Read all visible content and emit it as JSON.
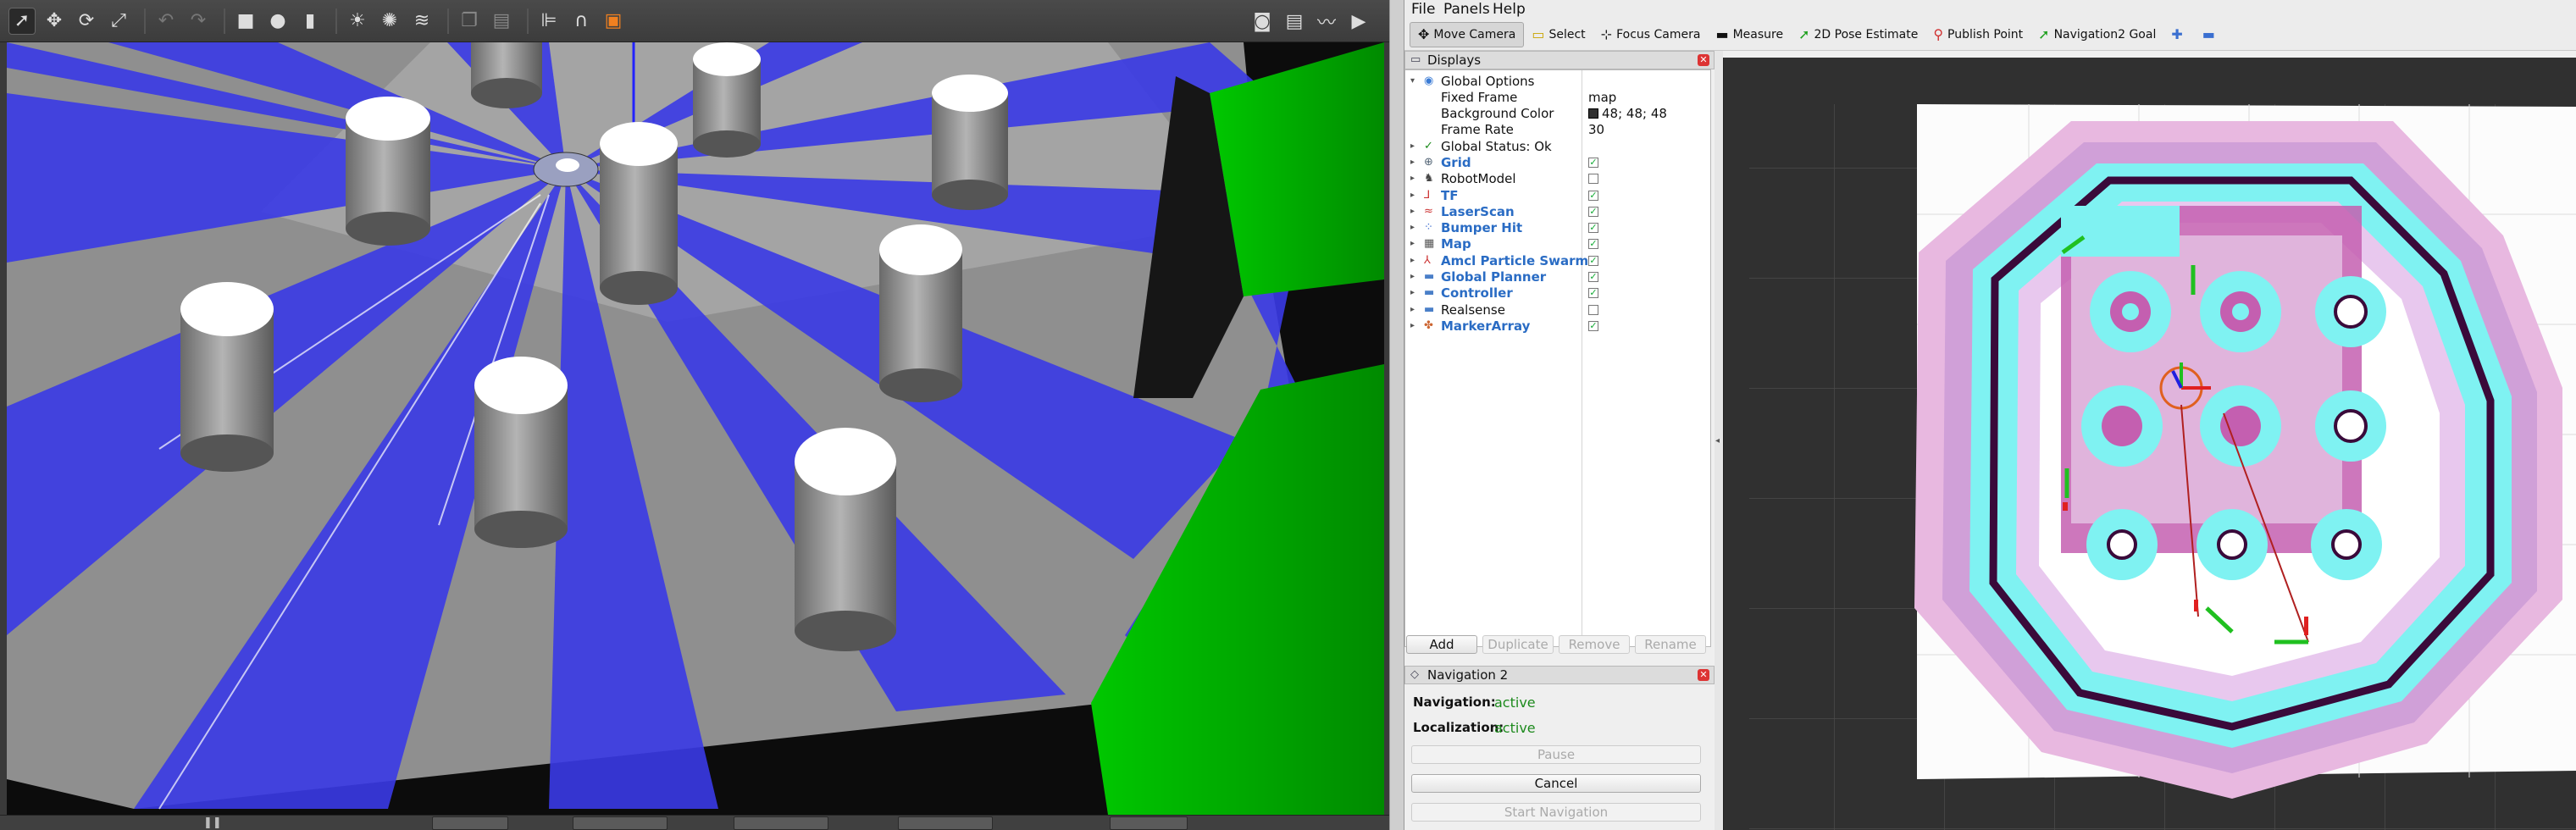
{
  "gazebo": {
    "toolbar_left": [
      "select-mode",
      "translate-mode",
      "rotate-mode",
      "scale-mode",
      "undo",
      "redo",
      "box-shape",
      "sphere-shape",
      "cylinder-shape",
      "point-light",
      "spot-light",
      "directional-light",
      "copy",
      "paste",
      "align",
      "snap",
      "change-view"
    ],
    "toolbar_right": [
      "screenshot",
      "log",
      "plot",
      "record-video"
    ]
  },
  "menubar": {
    "file": "File",
    "panels": "Panels",
    "help": "Help"
  },
  "toolbar": {
    "move_camera": "Move Camera",
    "select": "Select",
    "focus_camera": "Focus Camera",
    "measure": "Measure",
    "pose_estimate": "2D Pose Estimate",
    "publish_point": "Publish Point",
    "nav2_goal": "Navigation2 Goal"
  },
  "displays": {
    "title": "Displays",
    "global_options": {
      "label": "Global Options",
      "fixed_frame_label": "Fixed Frame",
      "fixed_frame_value": "map",
      "bg_color_label": "Background Color",
      "bg_color_value": "48; 48; 48",
      "frame_rate_label": "Frame Rate",
      "frame_rate_value": "30"
    },
    "global_status": "Global Status: Ok",
    "items": [
      {
        "label": "Grid",
        "checked": true,
        "blue": true
      },
      {
        "label": "RobotModel",
        "checked": false,
        "blue": false
      },
      {
        "label": "TF",
        "checked": true,
        "blue": true
      },
      {
        "label": "LaserScan",
        "checked": true,
        "blue": true
      },
      {
        "label": "Bumper Hit",
        "checked": true,
        "blue": true
      },
      {
        "label": "Map",
        "checked": true,
        "blue": true
      },
      {
        "label": "Amcl Particle Swarm",
        "checked": true,
        "blue": true
      },
      {
        "label": "Global Planner",
        "checked": true,
        "blue": true
      },
      {
        "label": "Controller",
        "checked": true,
        "blue": true
      },
      {
        "label": "Realsense",
        "checked": false,
        "blue": false
      },
      {
        "label": "MarkerArray",
        "checked": true,
        "blue": true
      }
    ],
    "buttons": {
      "add": "Add",
      "duplicate": "Duplicate",
      "remove": "Remove",
      "rename": "Rename"
    }
  },
  "nav2": {
    "title": "Navigation 2",
    "navigation_label": "Navigation:",
    "navigation_value": "active",
    "localization_label": "Localization:",
    "localization_value": "active",
    "pause": "Pause",
    "cancel": "Cancel",
    "start": "Start Navigation"
  },
  "colors": {
    "rviz_background": "#303030",
    "laser_blue": "#3a3ae6",
    "active_green": "#1d8a1d",
    "costmap_cyan": "#7ff2f2",
    "costmap_magenta": "#d23ca8",
    "gazebo_green_wall": "#00b000"
  }
}
